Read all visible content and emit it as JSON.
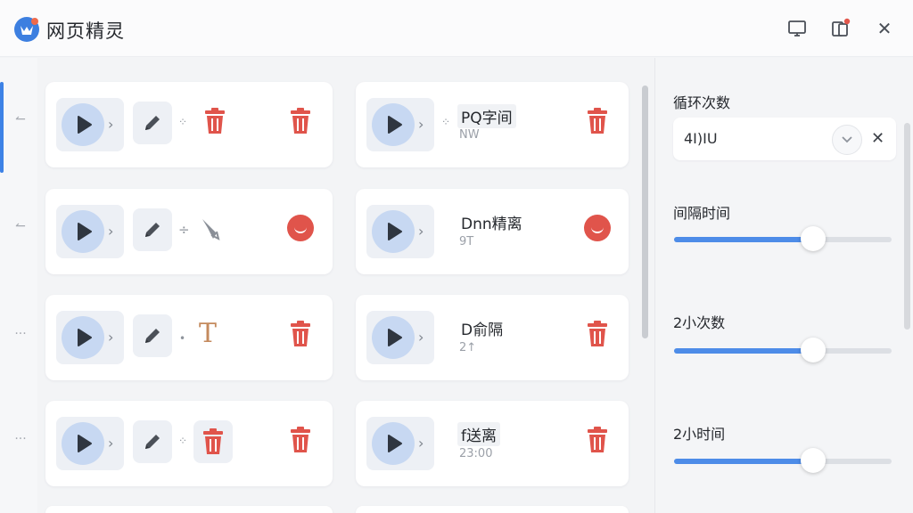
{
  "app": {
    "title": "网页精灵"
  },
  "titlebar": {
    "icons": [
      "monitor-icon",
      "device-notification-icon",
      "close-icon"
    ],
    "close_glyph": "✕"
  },
  "rail": {
    "handles": [
      "↼",
      "↼",
      "···",
      "···"
    ]
  },
  "left_cards": [
    {
      "middle": "trash",
      "right": "trash"
    },
    {
      "middle": "tool",
      "right": "circle"
    },
    {
      "middle": "T",
      "right": "trash"
    },
    {
      "middle": "trash-box",
      "right": "trash"
    }
  ],
  "right_cards": [
    {
      "title": "PQ字间",
      "sub": "NW",
      "right": "trash"
    },
    {
      "title": "Dnn精离",
      "sub": "9T",
      "right": "circle"
    },
    {
      "title": "D俞隔",
      "sub": "2↑",
      "right": "trash"
    },
    {
      "title": "f送离",
      "sub": "23:00",
      "right": "trash"
    }
  ],
  "settings": {
    "loop_label": "循环次数",
    "loop_value": "4I)IU",
    "interval_label": "间隔时间",
    "interval_fraction": 0.64,
    "count_label": "2小次数",
    "count_fraction": 0.64,
    "time_label": "2小时间",
    "time_fraction": 0.64
  },
  "colors": {
    "accent": "#4d8ce8",
    "danger": "#e0544b",
    "play": "#c7d8f2"
  }
}
